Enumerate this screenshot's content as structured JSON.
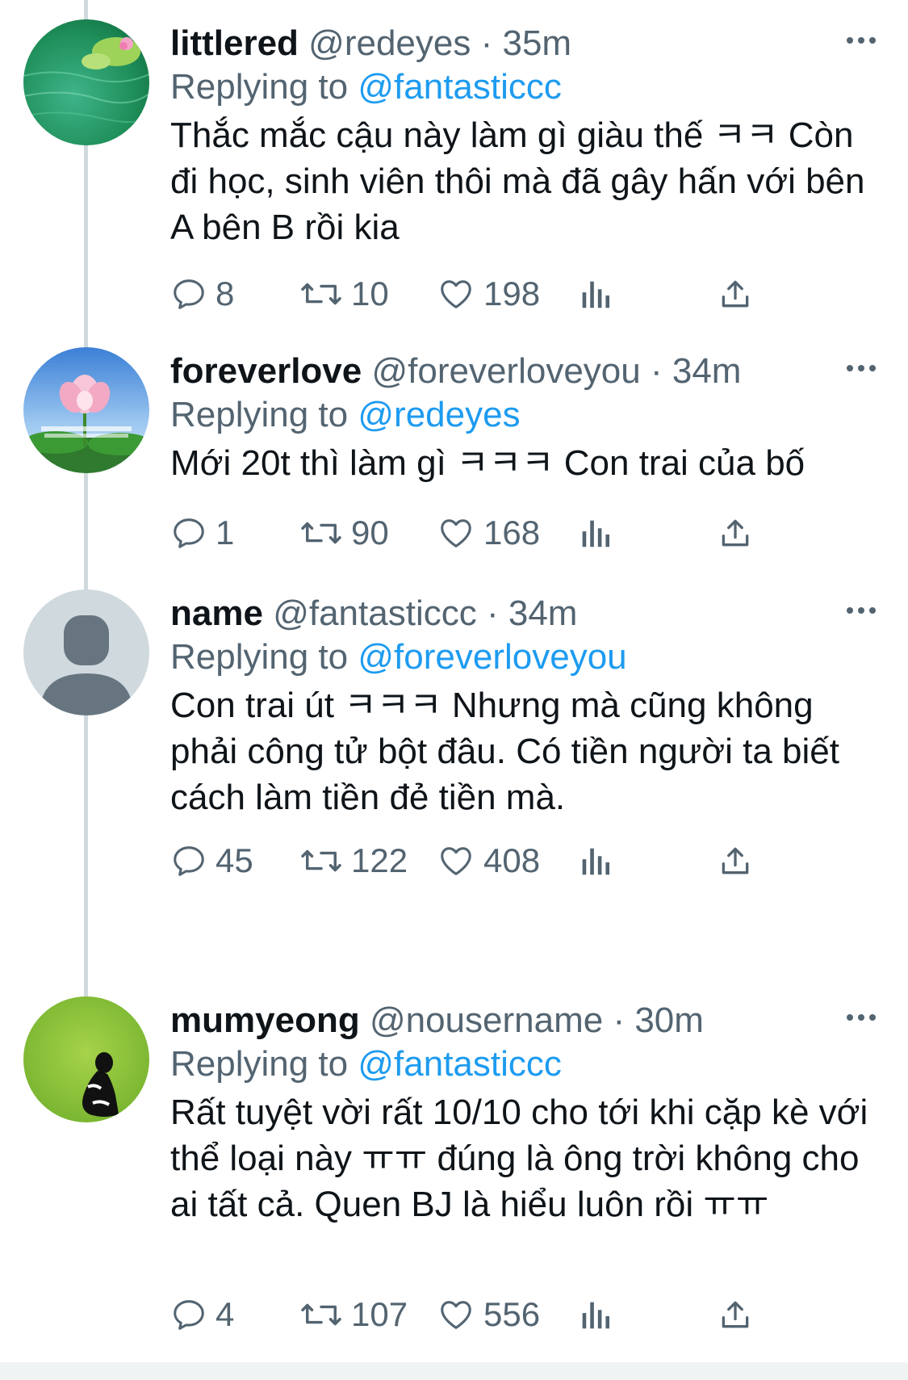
{
  "tweets": [
    {
      "name": "littlered",
      "handle": "@redeyes",
      "time": "35m",
      "replying_prefix": "Replying to",
      "replying_to": "@fantasticcc",
      "text": "Thắc mắc cậu này làm gì giàu thế ㅋㅋ Còn đi học, sinh viên thôi mà đã gây hấn với bên A bên B rồi kia",
      "replies": "8",
      "retweets": "10",
      "likes": "198",
      "avatar": "water-lotus-leaf"
    },
    {
      "name": "foreverlove",
      "handle": "@foreverloveyou",
      "time": "34m",
      "replying_prefix": "Replying to",
      "replying_to": "@redeyes",
      "text": "Mới 20t thì làm gì ㅋㅋㅋ Con trai của bố",
      "replies": "1",
      "retweets": "90",
      "likes": "168",
      "avatar": "lotus-flower"
    },
    {
      "name": "name",
      "handle": "@fantasticcc",
      "time": "34m",
      "replying_prefix": "Replying to",
      "replying_to": "@foreverloveyou",
      "text": "Con trai út ㅋㅋㅋ Nhưng mà cũng không phải công tử bột đâu. Có tiền người ta biết cách làm tiền đẻ tiền mà.",
      "replies": "45",
      "retweets": "122",
      "likes": "408",
      "avatar": "default-person"
    },
    {
      "name": "mumyeong",
      "handle": "@nousername",
      "time": "30m",
      "replying_prefix": "Replying to",
      "replying_to": "@fantasticcc",
      "text": "Rất tuyệt vời rất 10/10 cho tới khi cặp kè với thể loại này ㅠㅠ đúng là ông trời không cho ai tất cả. Quen BJ là hiểu luôn rồi ㅠㅠ",
      "replies": "4",
      "retweets": "107",
      "likes": "556",
      "avatar": "green-silhouette"
    }
  ],
  "separator": "·",
  "icons": [
    "reply-icon",
    "retweet-icon",
    "like-icon",
    "analytics-icon",
    "share-icon",
    "more-icon"
  ],
  "colors": {
    "accent": "#1d9bf0",
    "secondary": "#536471",
    "text": "#0f1419"
  }
}
